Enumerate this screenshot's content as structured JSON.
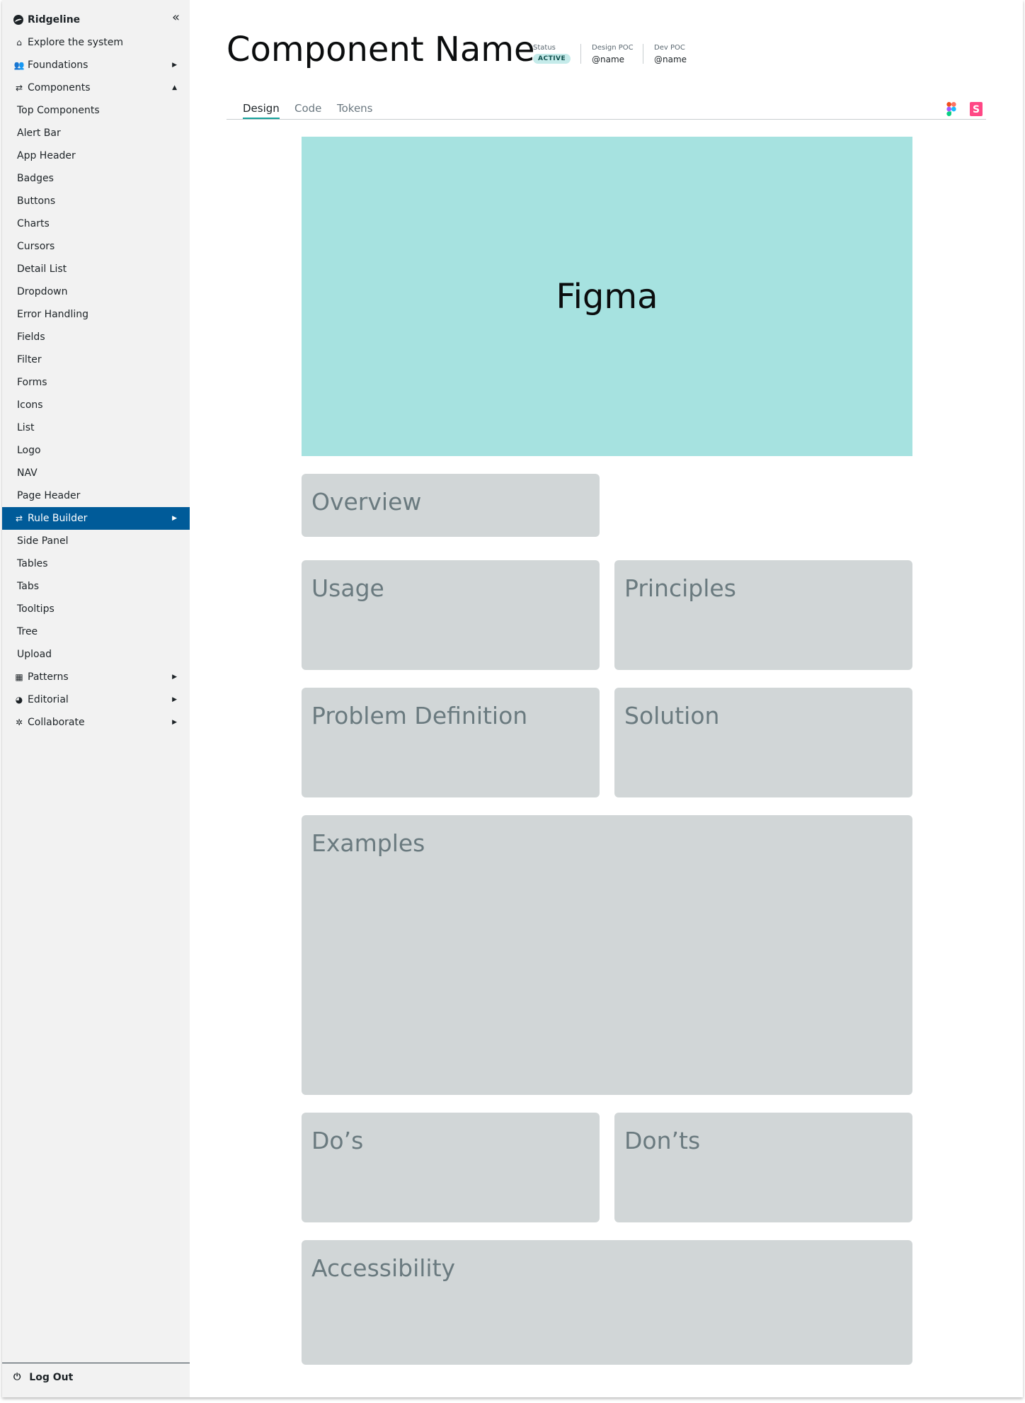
{
  "sidebar": {
    "brand": "Ridgeline",
    "items": [
      {
        "label": "Explore the system",
        "icon": "home-icon",
        "glyph": "⌂",
        "type": "top"
      },
      {
        "label": "Foundations",
        "icon": "users-icon",
        "glyph": "👥",
        "type": "top",
        "arrow": "▶"
      },
      {
        "label": "Components",
        "icon": "swap-icon",
        "glyph": "⇄",
        "type": "top",
        "arrow": "▲"
      },
      {
        "label": "Top Components",
        "type": "sub"
      },
      {
        "label": "Alert Bar",
        "type": "sub"
      },
      {
        "label": "App Header",
        "type": "sub"
      },
      {
        "label": "Badges",
        "type": "sub"
      },
      {
        "label": "Buttons",
        "type": "sub"
      },
      {
        "label": "Charts",
        "type": "sub"
      },
      {
        "label": "Cursors",
        "type": "sub"
      },
      {
        "label": "Detail List",
        "type": "sub"
      },
      {
        "label": "Dropdown",
        "type": "sub"
      },
      {
        "label": "Error Handling",
        "type": "sub"
      },
      {
        "label": "Fields",
        "type": "sub"
      },
      {
        "label": "Filter",
        "type": "sub"
      },
      {
        "label": "Forms",
        "type": "sub"
      },
      {
        "label": "Icons",
        "type": "sub"
      },
      {
        "label": "List",
        "type": "sub"
      },
      {
        "label": "Logo",
        "type": "sub"
      },
      {
        "label": "NAV",
        "type": "sub"
      },
      {
        "label": "Page Header",
        "type": "sub"
      },
      {
        "label": "Rule Builder",
        "icon": "swap-icon",
        "glyph": "⇄",
        "type": "top",
        "arrow": "▶",
        "active": true
      },
      {
        "label": "Side Panel",
        "type": "sub"
      },
      {
        "label": "Tables",
        "type": "sub"
      },
      {
        "label": "Tabs",
        "type": "sub"
      },
      {
        "label": "Tooltips",
        "type": "sub"
      },
      {
        "label": "Tree",
        "type": "sub"
      },
      {
        "label": "Upload",
        "type": "sub"
      },
      {
        "label": "Patterns",
        "icon": "calculator-icon",
        "glyph": "▦",
        "type": "top",
        "arrow": "▶"
      },
      {
        "label": "Editorial",
        "icon": "pie-chart-icon",
        "glyph": "◕",
        "type": "top",
        "arrow": "▶"
      },
      {
        "label": "Collaborate",
        "icon": "gear-icon",
        "glyph": "✲",
        "type": "top",
        "arrow": "▶"
      }
    ],
    "logout": "Log Out"
  },
  "header": {
    "title": "Component Name",
    "status_label": "Status",
    "status_value": "ACTIVE",
    "design_poc_label": "Design POC",
    "design_poc_value": "@name",
    "dev_poc_label": "Dev POC",
    "dev_poc_value": "@name"
  },
  "tabs": [
    "Design",
    "Code",
    "Tokens"
  ],
  "hero_label": "Figma",
  "sections": {
    "overview": "Overview",
    "usage": "Usage",
    "principles": "Principles",
    "problem": "Problem Definition",
    "solution": "Solution",
    "examples": "Examples",
    "dos": "Do’s",
    "donts": "Don’ts",
    "accessibility": "Accessibility"
  },
  "colors": {
    "accent": "#15a19a",
    "active_nav": "#005b99",
    "hero": "#a6e2e0",
    "card": "#d1d6d7"
  }
}
